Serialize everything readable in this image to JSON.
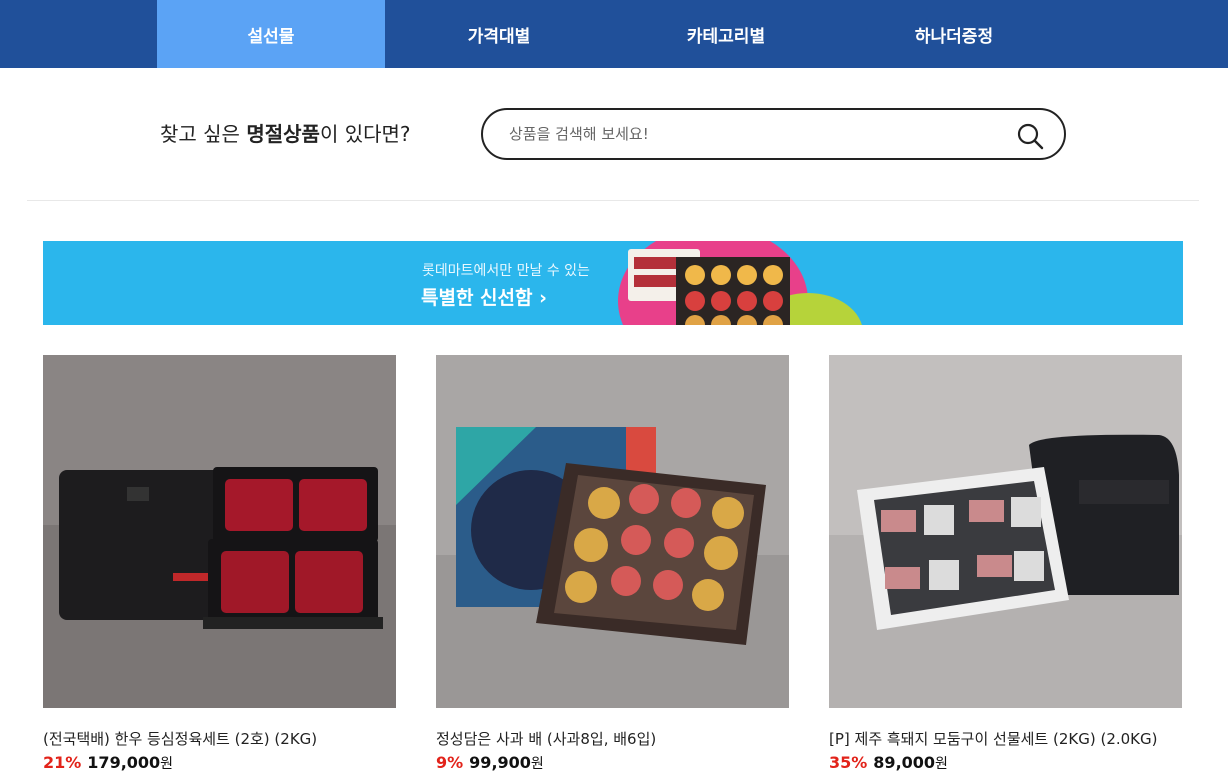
{
  "nav": {
    "tabs": [
      {
        "label": "설선물",
        "active": true
      },
      {
        "label": "가격대별",
        "active": false
      },
      {
        "label": "카테고리별",
        "active": false
      },
      {
        "label": "하나더증정",
        "active": false
      }
    ]
  },
  "search": {
    "label_prefix": "찾고 싶은 ",
    "label_bold": "명절상품",
    "label_suffix": "이 있다면?",
    "placeholder": "상품을 검색해 보세요!"
  },
  "banner": {
    "subtitle": "롯데마트에서만 만날 수 있는",
    "title": "특별한 신선함 ›"
  },
  "products": [
    {
      "name": "(전국택배) 한우 등심정육세트 (2호) (2KG)",
      "discount": "21%",
      "price": "179,000",
      "unit": "원"
    },
    {
      "name": "정성담은 사과 배 (사과8입, 배6입)",
      "discount": "9%",
      "price": "99,900",
      "unit": "원"
    },
    {
      "name": "[P] 제주 흑돼지 모둠구이 선물세트 (2KG) (2.0KG)",
      "discount": "35%",
      "price": "89,000",
      "unit": "원"
    }
  ],
  "colors": {
    "nav_bg": "#20509a",
    "nav_active": "#5ba3f5",
    "banner_bg": "#2bb6ec",
    "discount": "#e2231a"
  },
  "icons": {
    "search": "search-icon"
  }
}
